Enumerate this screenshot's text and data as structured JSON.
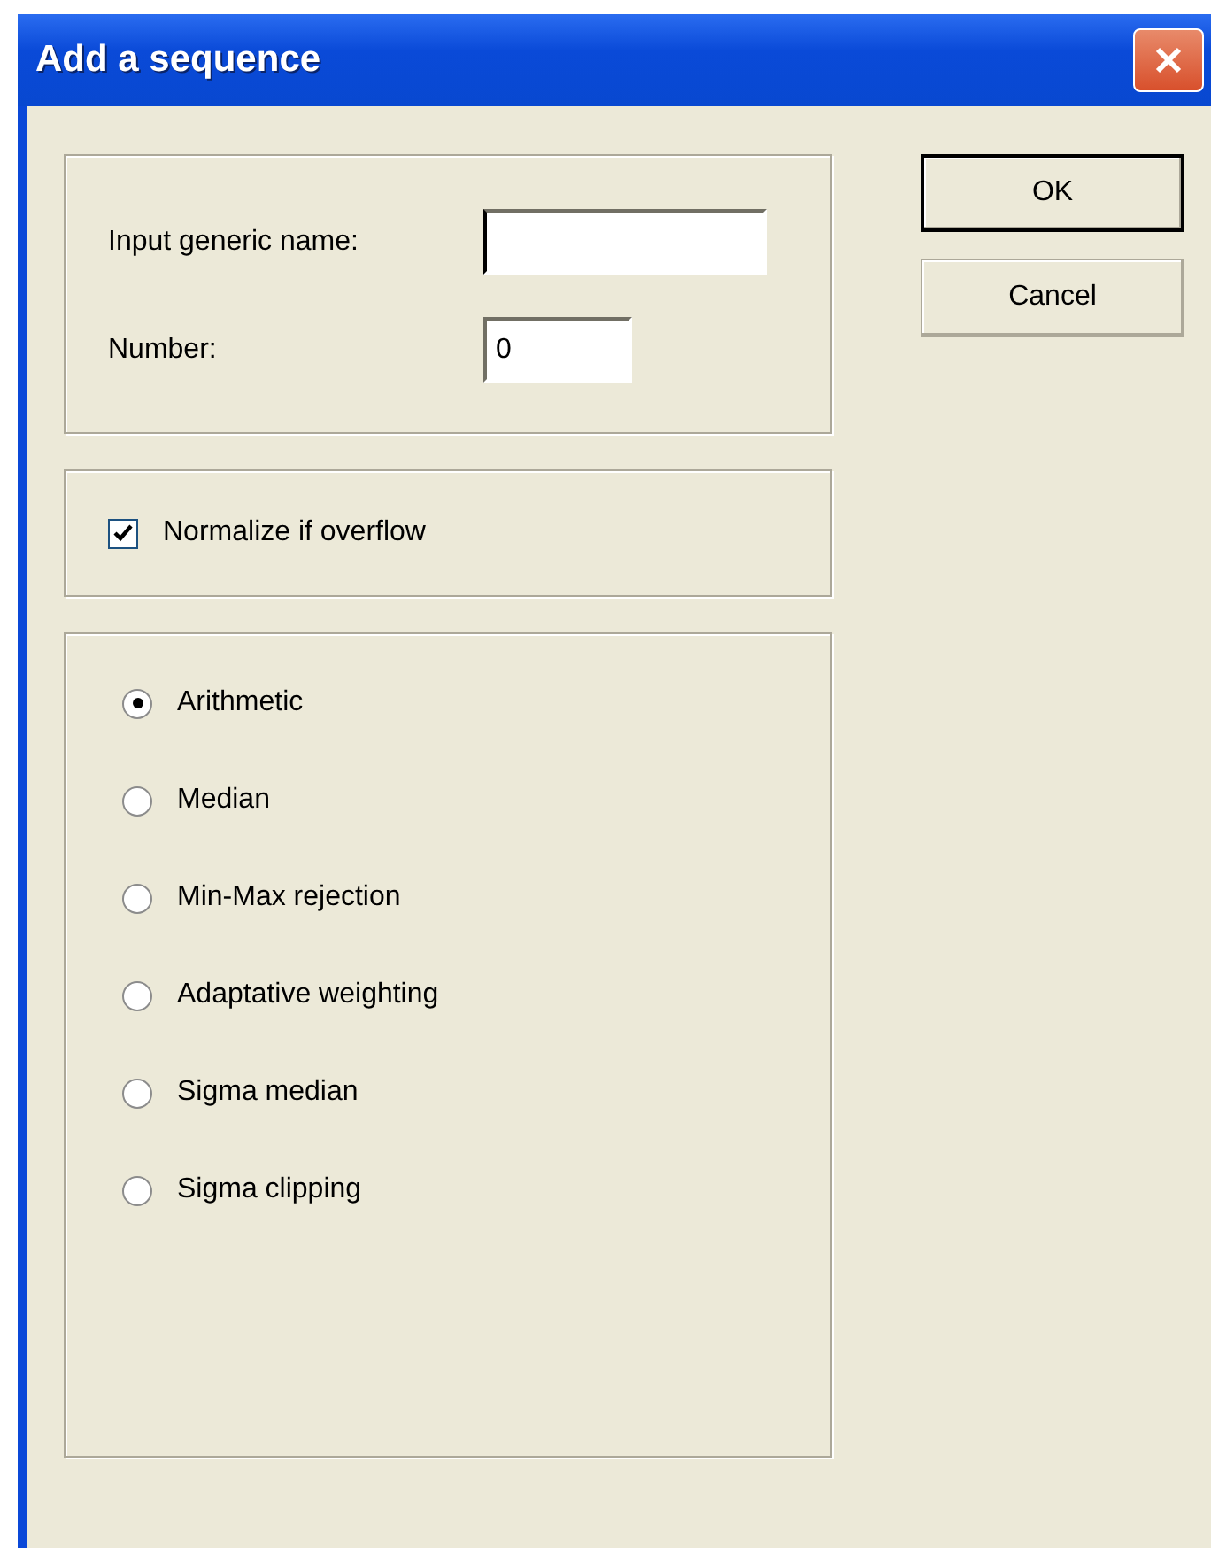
{
  "window": {
    "title": "Add a sequence"
  },
  "fields": [
    {
      "label": "Input generic name:",
      "focused": true
    },
    {
      "label": "Number:",
      "value": "0",
      "focused": false
    }
  ],
  "checkbox": {
    "label": "Normalize if overflow",
    "checked": true
  },
  "methods": [
    {
      "label": "Arithmetic",
      "selected": true
    },
    {
      "label": "Median",
      "selected": false
    },
    {
      "label": "Min-Max rejection",
      "selected": false
    },
    {
      "label": "Adaptative weighting",
      "selected": false
    },
    {
      "label": "Sigma median",
      "selected": false
    },
    {
      "label": "Sigma clipping",
      "selected": false
    }
  ],
  "buttons": [
    {
      "label": "OK",
      "default": true
    },
    {
      "label": "Cancel",
      "default": false
    }
  ]
}
